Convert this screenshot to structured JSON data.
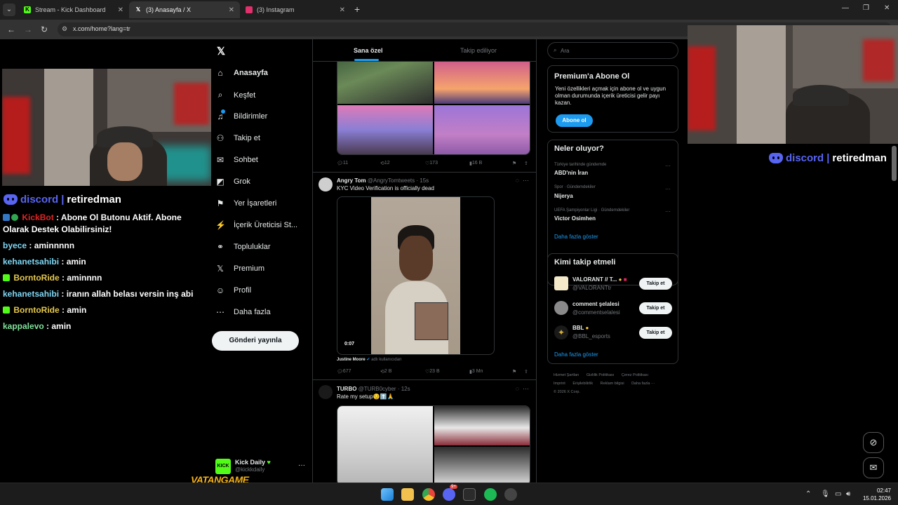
{
  "browser": {
    "tabs": [
      {
        "title": "Stream - Kick Dashboard",
        "active": false,
        "favicon": "kick-icon",
        "color": "#53fc18"
      },
      {
        "title": "(3) Anasayfa / X",
        "active": true,
        "favicon": "x-icon",
        "color": "#ffffff"
      },
      {
        "title": "(3) Instagram",
        "active": false,
        "favicon": "instagram-icon",
        "color": "#e1306c"
      }
    ],
    "url": "x.com/home?lang=tr"
  },
  "stream": {
    "discord_word": "discord",
    "discord_sep": "|",
    "discord_name": "retiredman",
    "chat": [
      {
        "user": "KickBot",
        "color": "#e02424",
        "text": ": Abone Ol Butonu Aktif. Abone Olarak Destek Olabilirsiniz!",
        "badge": "bot"
      },
      {
        "user": "byece",
        "color": "#7fd7f5",
        "text": ": aminnnnn",
        "badge": ""
      },
      {
        "user": "kehanetsahibi",
        "color": "#7fd7f5",
        "text": ": amin",
        "badge": ""
      },
      {
        "user": "BorntoRide",
        "color": "#e5c84c",
        "text": ": aminnnn",
        "badge": "sub"
      },
      {
        "user": "kehanetsahibi",
        "color": "#7fd7f5",
        "text": ": iranın allah belası versin inş abi",
        "badge": ""
      },
      {
        "user": "BorntoRide",
        "color": "#e5c84c",
        "text": ": amin",
        "badge": "sub"
      },
      {
        "user": "kappalevo",
        "color": "#7fe39a",
        "text": ": amin",
        "badge": ""
      }
    ],
    "sponsor": "VATANGAME"
  },
  "x": {
    "nav": [
      {
        "label": "Anasayfa",
        "icon": "home-icon",
        "glyph": "⌂",
        "active": true
      },
      {
        "label": "Keşfet",
        "icon": "search-icon",
        "glyph": "⌕",
        "active": false
      },
      {
        "label": "Bildirimler",
        "icon": "bell-icon",
        "glyph": "♫",
        "active": false
      },
      {
        "label": "Takip et",
        "icon": "follow-icon",
        "glyph": "⚇",
        "active": false
      },
      {
        "label": "Sohbet",
        "icon": "mail-icon",
        "glyph": "✉",
        "active": false
      },
      {
        "label": "Grok",
        "icon": "grok-icon",
        "glyph": "◩",
        "active": false
      },
      {
        "label": "Yer İşaretleri",
        "icon": "bookmark-icon",
        "glyph": "⚑",
        "active": false
      },
      {
        "label": "İçerik Üreticisi St...",
        "icon": "creator-studio-icon",
        "glyph": "⚡",
        "active": false
      },
      {
        "label": "Topluluklar",
        "icon": "communities-icon",
        "glyph": "⚭",
        "active": false
      },
      {
        "label": "Premium",
        "icon": "premium-icon",
        "glyph": "𝕏",
        "active": false
      },
      {
        "label": "Profil",
        "icon": "profile-icon",
        "glyph": "☺",
        "active": false
      },
      {
        "label": "Daha fazla",
        "icon": "more-icon",
        "glyph": "⋯",
        "active": false
      }
    ],
    "post_button": "Gönderi yayınla",
    "account": {
      "name": "Kick Daily",
      "handle": "@kickkdaily",
      "avatar_text": "KICK"
    },
    "feed_tabs": [
      "Sana özel",
      "Takip ediliyor"
    ],
    "tweets": [
      {
        "stats": {
          "replies": "11",
          "retweets": "12",
          "likes": "173",
          "views": "16 B"
        }
      },
      {
        "name": "Angry Tom",
        "handle": "@AngryTomtweets",
        "time": "· 15s",
        "text": "KYC Video Verification is officially dead",
        "video_time": "0:07",
        "attribution_name": "Justine Moore",
        "attribution_suffix": "adlı kullanıcıdan",
        "stats": {
          "replies": "677",
          "retweets": "2 B",
          "likes": "23 B",
          "views": "3 Mn"
        }
      },
      {
        "name": "TURBO",
        "handle": "@TURB0cyber",
        "time": "· 12s",
        "text": "Rate my setup😏⬆️🙏"
      }
    ],
    "search_placeholder": "Ara",
    "premium": {
      "title": "Premium'a Abone Ol",
      "desc": "Yeni özellikleri açmak için abone ol ve uygun olman durumunda içerik üreticisi gelir payı kazan.",
      "button": "Abone ol"
    },
    "trends": {
      "title": "Neler oluyor?",
      "items": [
        {
          "context": "Türkiye tarihinde gündemde",
          "name": "ABD'nin İran"
        },
        {
          "context": "Spor · Gündemdekiler",
          "name": "Nijerya"
        },
        {
          "context": "UEFA Şampiyonlar Ligi · Gündemdekiler",
          "name": "Victor Osimhen"
        }
      ],
      "show_more": "Daha fazla göster"
    },
    "who_to_follow": {
      "title": "Kimi takip etmeli",
      "items": [
        {
          "name": "VALORANT // T...",
          "handle": "@VALORANTtr",
          "button": "Takip et",
          "avatar_color": "#f4e9c9"
        },
        {
          "name": "comment şelalesi",
          "handle": "@commentselalesi",
          "button": "Takip et",
          "avatar_color": "#8a8a8a"
        },
        {
          "name": "BBL",
          "handle": "@BBL_esports",
          "button": "Takip et",
          "avatar_color": "#1a1a1a"
        }
      ],
      "show_more": "Daha fazla göster"
    },
    "footer": [
      "Hizmet Şartları",
      "Gizlilik Politikası",
      "Çerez Politikası",
      "Imprint",
      "Erişilebilirlik",
      "Reklam bilgisi",
      "Daha fazla ···",
      "© 2026 X Corp."
    ]
  },
  "taskbar": {
    "time": "02:47",
    "date": "15.01.2026",
    "apps": [
      {
        "icon": "windows-start-icon",
        "color": "#3aa0f0"
      },
      {
        "icon": "file-explorer-icon",
        "color": "#f2c14e"
      },
      {
        "icon": "chrome-icon",
        "color": "#e8453c"
      },
      {
        "icon": "discord-icon",
        "color": "#5865f2"
      },
      {
        "icon": "terminal-icon",
        "color": "#2b2b2b"
      },
      {
        "icon": "spotify-icon",
        "color": "#1db954"
      },
      {
        "icon": "obs-icon",
        "color": "#444444"
      }
    ],
    "discord_badge": "9+"
  }
}
